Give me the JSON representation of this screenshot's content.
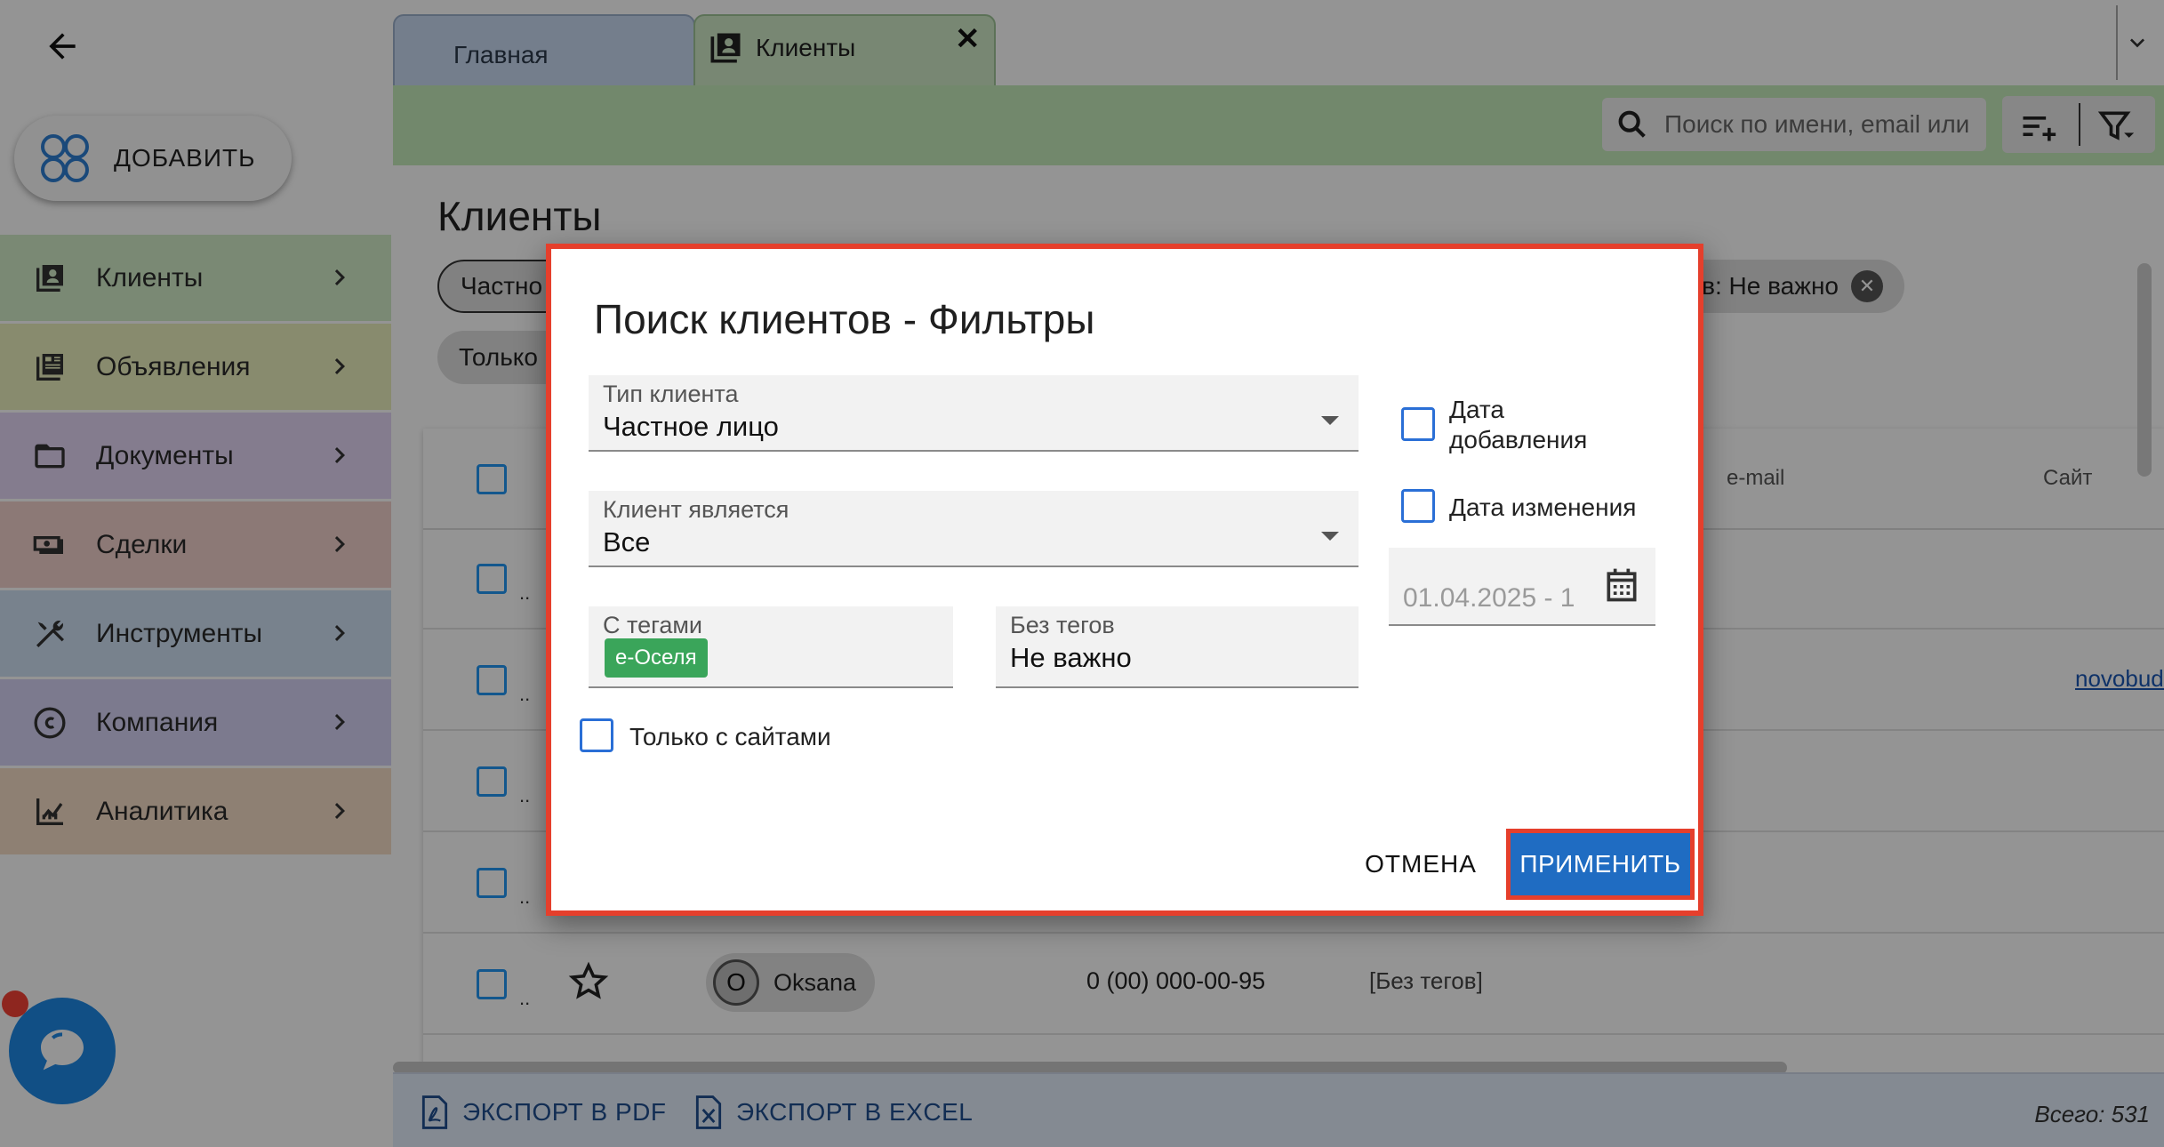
{
  "sidebar": {
    "add_label": "ДОБАВИТЬ",
    "items": [
      {
        "label": "Клиенты",
        "color": "#d3ecc9",
        "icon": "contacts-icon"
      },
      {
        "label": "Объявления",
        "color": "#eaefbd",
        "icon": "listings-icon"
      },
      {
        "label": "Документы",
        "color": "#e4d6f5",
        "icon": "folder-icon"
      },
      {
        "label": "Сделки",
        "color": "#f2d0cc",
        "icon": "money-icon"
      },
      {
        "label": "Инструменты",
        "color": "#cfe0f3",
        "icon": "tools-icon"
      },
      {
        "label": "Компания",
        "color": "#d6d2f5",
        "icon": "copyright-icon"
      },
      {
        "label": "Аналитика",
        "color": "#f4dcc6",
        "icon": "analytics-icon"
      }
    ]
  },
  "tabs": {
    "home": "Главная",
    "clients": "Клиенты",
    "close": "✕"
  },
  "search": {
    "placeholder": "Поиск по имени, email или"
  },
  "page": {
    "title": "Клиенты",
    "chip_private": "Частно",
    "chip_notags": "в: Не важно",
    "chip_only": "Только"
  },
  "table": {
    "col_email": "e-mail",
    "col_site": "Сайт",
    "row_dots": "..",
    "site_link": "novobudo",
    "person_initial": "O",
    "person_name": "Oksana",
    "person_phone": "0 (00) 000-00-95",
    "person_tags": "[Без тегов]"
  },
  "footer": {
    "export_pdf": "ЭКСПОРТ В PDF",
    "export_excel": "ЭКСПОРТ В EXCEL",
    "total": "Всего: 531"
  },
  "dialog": {
    "title": "Поиск клиентов - Фильтры",
    "client_type_label": "Тип клиента",
    "client_type_value": "Частное лицо",
    "client_is_label": "Клиент является",
    "client_is_value": "Все",
    "with_tags_label": "С тегами",
    "with_tags_chip": "е-Оселя",
    "without_tags_label": "Без тегов",
    "without_tags_value": "Не важно",
    "only_sites_label": "Только с сайтами",
    "date_added_label_1": "Дата",
    "date_added_label_2": "добавления",
    "date_changed_label": "Дата изменения",
    "date_range_value": "01.04.2025 - 1",
    "cancel_label": "ОТМЕНА",
    "apply_label": "ПРИМЕНИТЬ"
  },
  "colors": {
    "accent": "#1f6cc2",
    "highlight": "#e53f2c",
    "toolbar": "#c5eabb",
    "tag": "#3aa55a"
  }
}
